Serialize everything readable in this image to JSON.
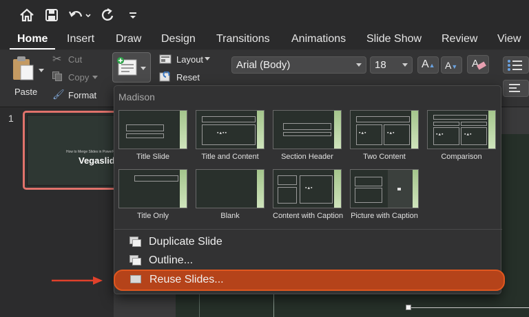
{
  "titlebar": {
    "icons": [
      "home-icon",
      "save-icon",
      "undo-icon",
      "redo-icon",
      "customize-icon"
    ]
  },
  "tabs": [
    "Home",
    "Insert",
    "Draw",
    "Design",
    "Transitions",
    "Animations",
    "Slide Show",
    "Review",
    "View"
  ],
  "ribbon": {
    "paste_label": "Paste",
    "cut_label": "Cut",
    "copy_label": "Copy",
    "format_label": "Format",
    "layout_label": "Layout",
    "reset_label": "Reset",
    "font_name": "Arial (Body)",
    "font_size": "18"
  },
  "slides_pane": {
    "slide_number": "1",
    "thumb_subtitle": "How to Merge Slides in PowerPoint",
    "thumb_title": "Vegaslide"
  },
  "layout_menu": {
    "theme_name": "Madison",
    "layouts": [
      {
        "name": "Title Slide"
      },
      {
        "name": "Title and Content"
      },
      {
        "name": "Section Header"
      },
      {
        "name": "Two Content"
      },
      {
        "name": "Comparison"
      },
      {
        "name": "Title Only"
      },
      {
        "name": "Blank"
      },
      {
        "name": "Content with Caption"
      },
      {
        "name": "Picture with Caption"
      }
    ],
    "items": {
      "duplicate": "Duplicate Slide",
      "outline": "Outline...",
      "reuse": "Reuse Slides..."
    }
  },
  "colors": {
    "highlight": "#e0571f",
    "arrow": "#e0412b",
    "thumb_border": "#e0726b"
  }
}
